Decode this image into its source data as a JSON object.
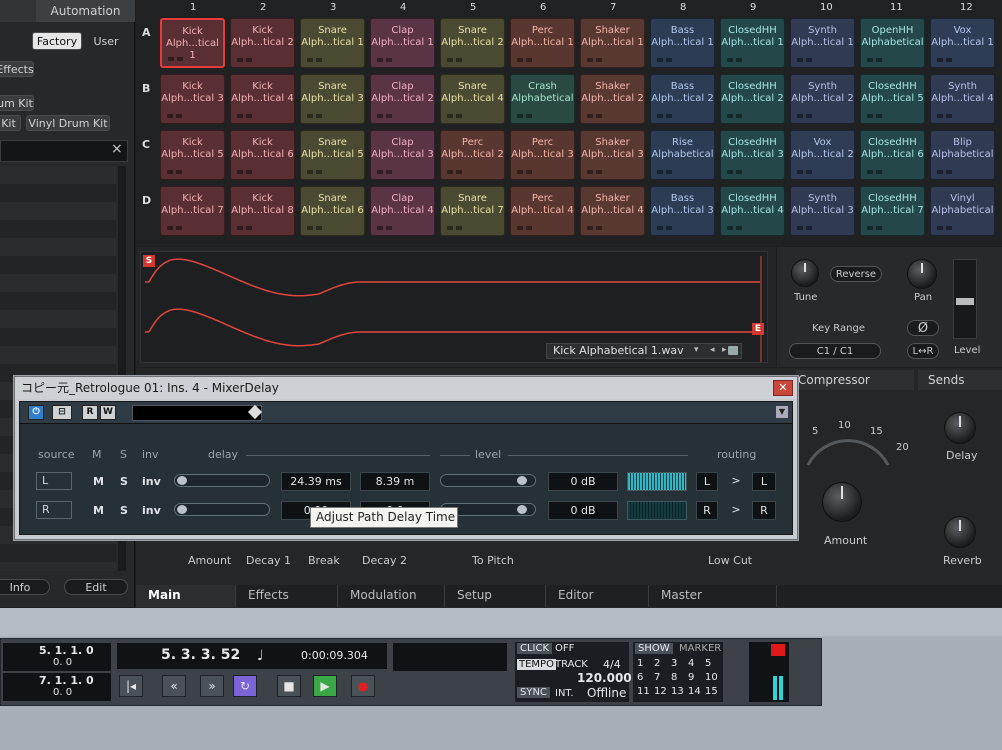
{
  "left_panel": {
    "tab_automation": "Automation",
    "factory_btn": "Factory",
    "user_btn": "User",
    "effects_tag": "Effects",
    "kit1": "um Kit",
    "kit2": "Kit",
    "kit3": "Vinyl Drum Kit",
    "search_close": "×",
    "info_btn": "Info",
    "edit_btn": "Edit"
  },
  "pads": {
    "columns": [
      "1",
      "2",
      "3",
      "4",
      "5",
      "6",
      "7",
      "8",
      "9",
      "10",
      "11",
      "12"
    ],
    "rows": [
      "A",
      "B",
      "C",
      "D"
    ],
    "grid": [
      [
        [
          "Kick",
          "Alph...tical 1",
          "kick"
        ],
        [
          "Kick",
          "Alph...tical 2",
          "kick"
        ],
        [
          "Snare",
          "Alph...tical 1",
          "snare"
        ],
        [
          "Clap",
          "Alph...tical 1",
          "clap"
        ],
        [
          "Snare",
          "Alph...tical 2",
          "snare"
        ],
        [
          "Perc",
          "Alph...tical 1",
          "perc"
        ],
        [
          "Shaker",
          "Alph...tical 1",
          "shaker"
        ],
        [
          "Bass",
          "Alph...tical 1",
          "bass"
        ],
        [
          "ClosedHH",
          "Alph...tical 1",
          "hh"
        ],
        [
          "Synth",
          "Alph...tical 1",
          "synth"
        ],
        [
          "OpenHH",
          "Alphabetical",
          "hh"
        ],
        [
          "Vox",
          "Alph...tical 1",
          "vox"
        ]
      ],
      [
        [
          "Kick",
          "Alph...tical 3",
          "kick"
        ],
        [
          "Kick",
          "Alph...tical 4",
          "kick"
        ],
        [
          "Snare",
          "Alph...tical 3",
          "snare"
        ],
        [
          "Clap",
          "Alph...tical 2",
          "clap"
        ],
        [
          "Snare",
          "Alph...tical 4",
          "snare"
        ],
        [
          "Crash",
          "Alphabetical",
          "crash"
        ],
        [
          "Shaker",
          "Alph...tical 2",
          "shaker"
        ],
        [
          "Bass",
          "Alph...tical 2",
          "bass"
        ],
        [
          "ClosedHH",
          "Alph...tical 2",
          "hh"
        ],
        [
          "Synth",
          "Alph...tical 2",
          "synth"
        ],
        [
          "ClosedHH",
          "Alph...tical 5",
          "hh"
        ],
        [
          "Synth",
          "Alph...tical 4",
          "synth"
        ]
      ],
      [
        [
          "Kick",
          "Alph...tical 5",
          "kick"
        ],
        [
          "Kick",
          "Alph...tical 6",
          "kick"
        ],
        [
          "Snare",
          "Alph...tical 5",
          "snare"
        ],
        [
          "Clap",
          "Alph...tical 3",
          "clap"
        ],
        [
          "Perc",
          "Alph...tical 2",
          "perc"
        ],
        [
          "Perc",
          "Alph...tical 3",
          "perc"
        ],
        [
          "Shaker",
          "Alph...tical 3",
          "shaker"
        ],
        [
          "Rise",
          "Alphabetical",
          "bass"
        ],
        [
          "ClosedHH",
          "Alph...tical 3",
          "hh"
        ],
        [
          "Vox",
          "Alph...tical 2",
          "vox"
        ],
        [
          "ClosedHH",
          "Alph...tical 6",
          "hh"
        ],
        [
          "Blip",
          "Alphabetical",
          "synth"
        ]
      ],
      [
        [
          "Kick",
          "Alph...tical 7",
          "kick"
        ],
        [
          "Kick",
          "Alph...tical 8",
          "kick"
        ],
        [
          "Snare",
          "Alph...tical 6",
          "snare"
        ],
        [
          "Clap",
          "Alph...tical 4",
          "clap"
        ],
        [
          "Snare",
          "Alph...tical 7",
          "snare"
        ],
        [
          "Perc",
          "Alph...tical 4",
          "perc"
        ],
        [
          "Shaker",
          "Alph...tical 4",
          "shaker"
        ],
        [
          "Bass",
          "Alph...tical 3",
          "bass"
        ],
        [
          "ClosedHH",
          "Alph...tical 4",
          "hh"
        ],
        [
          "Synth",
          "Alph...tical 3",
          "synth"
        ],
        [
          "ClosedHH",
          "Alph...tical 7",
          "hh"
        ],
        [
          "Vinyl",
          "Alphabetical",
          "synth"
        ]
      ]
    ]
  },
  "sample": {
    "start_marker": "S",
    "end_marker": "E",
    "file_name": "Kick Alphabetical 1.wav",
    "tune_label": "Tune",
    "reverse_label": "Reverse",
    "pan_label": "Pan",
    "level_label": "Level",
    "key_range_label": "Key Range",
    "key_range_value": "C1 / C1",
    "lr_label": "L↔R"
  },
  "lower": {
    "compressor_label": "Compressor",
    "sends_label": "Sends",
    "scale": [
      "5",
      "10",
      "15",
      "20"
    ],
    "amount_label": "Amount",
    "delay_label": "Delay",
    "reverb_label": "Reverb",
    "bottom_labels": [
      "Amount",
      "Decay 1",
      "Break",
      "Decay 2",
      "To Pitch",
      "Low Cut"
    ],
    "tabs": [
      "Main",
      "Effects",
      "Modulation",
      "Setup",
      "Editor",
      "Master"
    ]
  },
  "dialog": {
    "title": "コピー元_Retrologue 01: Ins. 4 - MixerDelay",
    "close": "✕",
    "tb_power": "⏻",
    "tb_r": "R",
    "tb_w": "W",
    "headers": {
      "source": "source",
      "m": "M",
      "s": "S",
      "inv": "inv",
      "delay": "delay",
      "level": "level",
      "routing": "routing"
    },
    "rows": [
      {
        "source": "L",
        "m": "M",
        "s": "S",
        "inv": "inv",
        "delay_ms": "24.39 ms",
        "delay_m": "8.39 m",
        "level": "0 dB",
        "route_in": "L",
        "route_arrow": ">",
        "route_out": "L",
        "delay_pos": 0.0,
        "level_pos": 0.95,
        "meter_active": true
      },
      {
        "source": "R",
        "m": "M",
        "s": "S",
        "inv": "inv",
        "delay_ms": "0.00",
        "delay_m": "0.0",
        "level": "0 dB",
        "route_in": "R",
        "route_arrow": ">",
        "route_out": "R",
        "delay_pos": 0.0,
        "level_pos": 0.95,
        "meter_active": false
      }
    ],
    "tooltip": "Adjust Path Delay Time"
  },
  "transport": {
    "left_pos1": "5. 1. 1. 0",
    "left_pos1b": "0. 0",
    "left_pos2": "7. 1. 1. 0",
    "left_pos2b": "0. 0",
    "position": "5. 3. 3. 52",
    "time": "0:00:09.304",
    "click_label": "CLICK",
    "click_value": "OFF",
    "tempo_label": "TEMPO",
    "track_label": "TRACK",
    "signature": "4/4",
    "tempo": "120.000",
    "sync_label": "SYNC",
    "int_label": "INT.",
    "offline_label": "Offline",
    "show_label": "SHOW",
    "marker_label": "MARKER",
    "markers": [
      "1",
      "2",
      "3",
      "4",
      "5",
      "6",
      "7",
      "8",
      "9",
      "10",
      "11",
      "12",
      "13",
      "14",
      "15"
    ]
  }
}
